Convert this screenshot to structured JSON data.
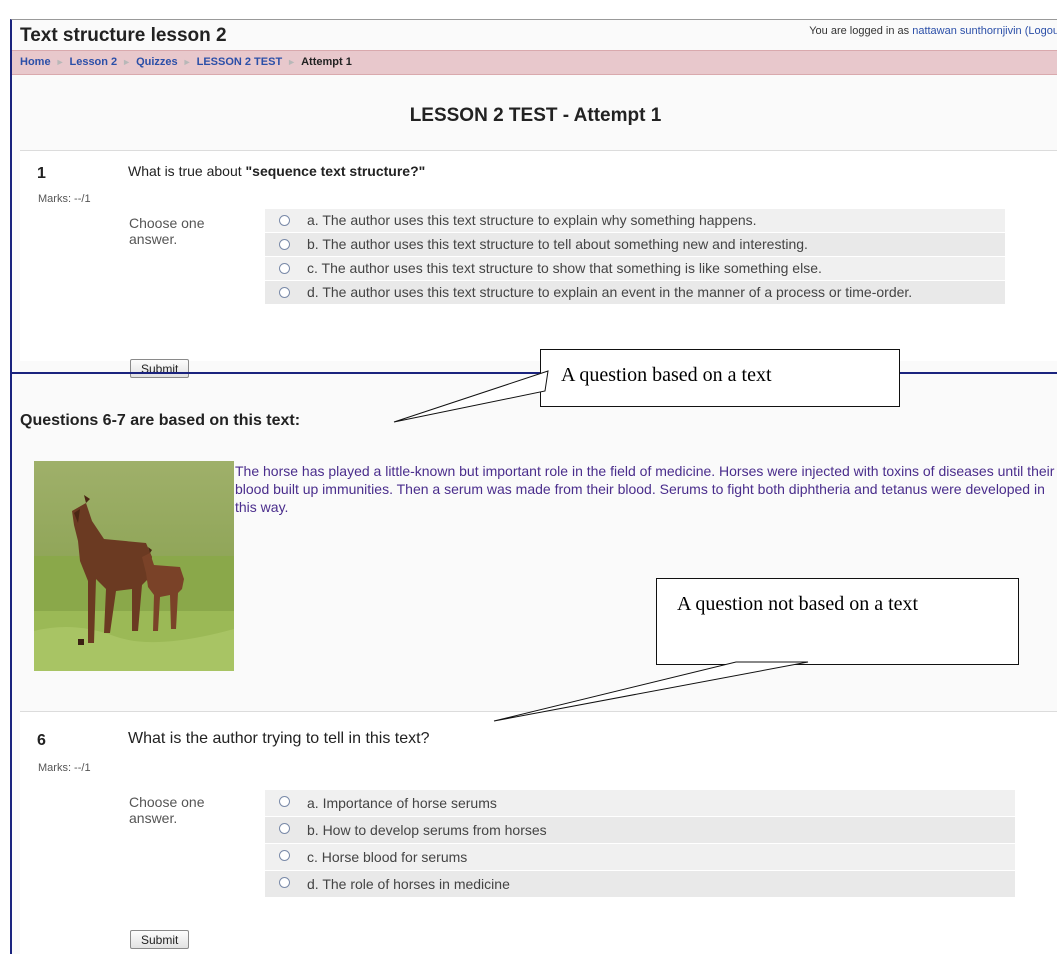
{
  "header": {
    "course_title": "Text structure lesson 2",
    "login_prefix": "You are logged in as",
    "user_name": "nattawan sunthornjivin",
    "logout": "(Logou"
  },
  "breadcrumb": {
    "home": "Home",
    "lesson": "Lesson 2",
    "quizzes": "Quizzes",
    "test": "LESSON 2 TEST",
    "current": "Attempt 1",
    "separator": "►"
  },
  "page_title": "LESSON 2 TEST - Attempt 1",
  "question1": {
    "number": "1",
    "marks": "Marks: --/1",
    "text_prefix": "What is true about",
    "text_bold": "\"sequence text structure?\"",
    "choose_label": "Choose one answer.",
    "answers": [
      "a. The author uses this text structure to explain why something happens.",
      "b. The author uses this text structure to tell about something new and interesting.",
      "c. The author uses this text structure to show that something is like something else.",
      "d. The author uses this text structure to explain an event in the manner of a process or time-order."
    ],
    "submit": "Submit"
  },
  "passage": {
    "heading": "Questions 6-7 are based on this text:",
    "text": "The horse has played a little-known but important role in the field of medicine. Horses were injected with toxins of diseases until their blood built up immunities. Then a serum was made from their blood. Serums to fight both diphtheria and tetanus were developed in this way."
  },
  "question6": {
    "number": "6",
    "marks": "Marks: --/1",
    "text": "What is the author trying to tell in this text?",
    "choose_label": "Choose one answer.",
    "answers": [
      "a. Importance of horse serums",
      "b. How to develop serums from horses",
      "c. Horse blood for serums",
      "d. The role of horses in medicine"
    ],
    "submit": "Submit"
  },
  "callouts": {
    "based_on_text": "A question based on a text",
    "not_based_on_text": "A question not based on a text"
  },
  "colors": {
    "navbar": "#e8c8cc",
    "link": "#2b4fa8",
    "passage_text": "#4a2d8c",
    "frame_border": "#1a237e"
  }
}
